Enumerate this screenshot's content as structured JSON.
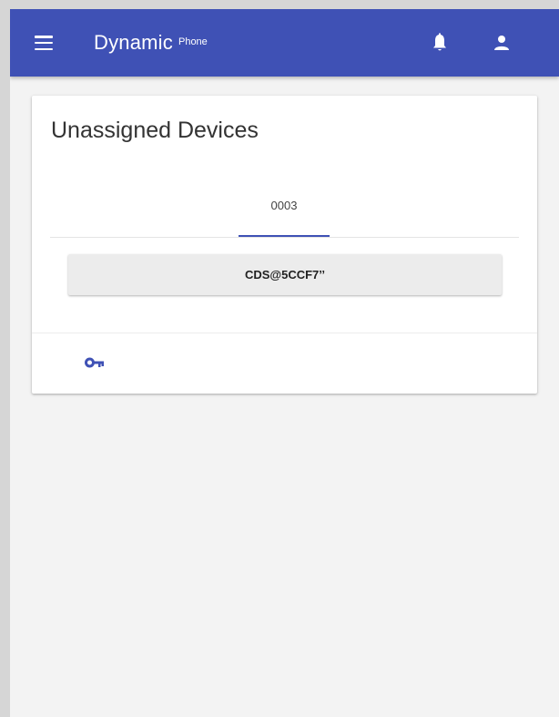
{
  "appbar": {
    "brand_main": "Dynamic",
    "brand_sub": "Phone",
    "menu_icon": "menu-icon",
    "notification_icon": "bell-icon",
    "account_icon": "person-icon",
    "color": "#3f51b5"
  },
  "card": {
    "title": "Unassigned Devices",
    "tabs": [
      {
        "label": "0003",
        "selected": true
      }
    ],
    "device_button_label": "CDS@5CCF7’’",
    "action_icon": "key-icon"
  },
  "colors": {
    "accent": "#3f51b5",
    "background": "#f3f3f3",
    "card": "#ffffff",
    "button": "#ececec"
  }
}
